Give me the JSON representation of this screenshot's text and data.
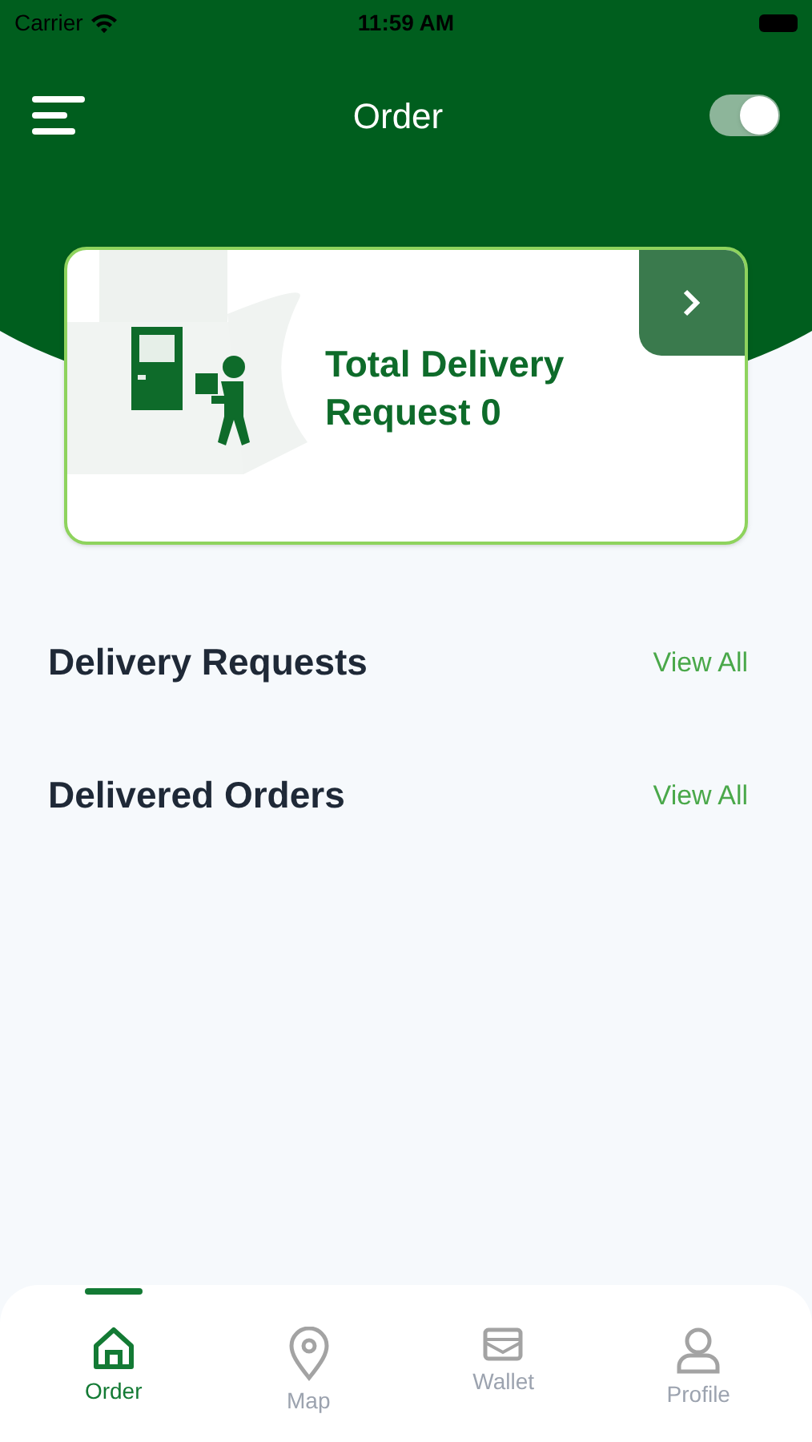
{
  "status_bar": {
    "carrier": "Carrier",
    "time": "11:59 AM"
  },
  "header": {
    "title": "Order",
    "toggle": {
      "on": true
    }
  },
  "summary_card": {
    "text": "Total Delivery Request 0"
  },
  "sections": [
    {
      "title": "Delivery Requests",
      "link": "View All"
    },
    {
      "title": "Delivered Orders",
      "link": "View All"
    }
  ],
  "tab_bar": [
    {
      "label": "Order",
      "kind": "home",
      "selected": true
    },
    {
      "label": "Map",
      "kind": "map",
      "selected": false
    },
    {
      "label": "Wallet",
      "kind": "wallet",
      "selected": false
    },
    {
      "label": "Profile",
      "kind": "profile",
      "selected": false
    }
  ]
}
